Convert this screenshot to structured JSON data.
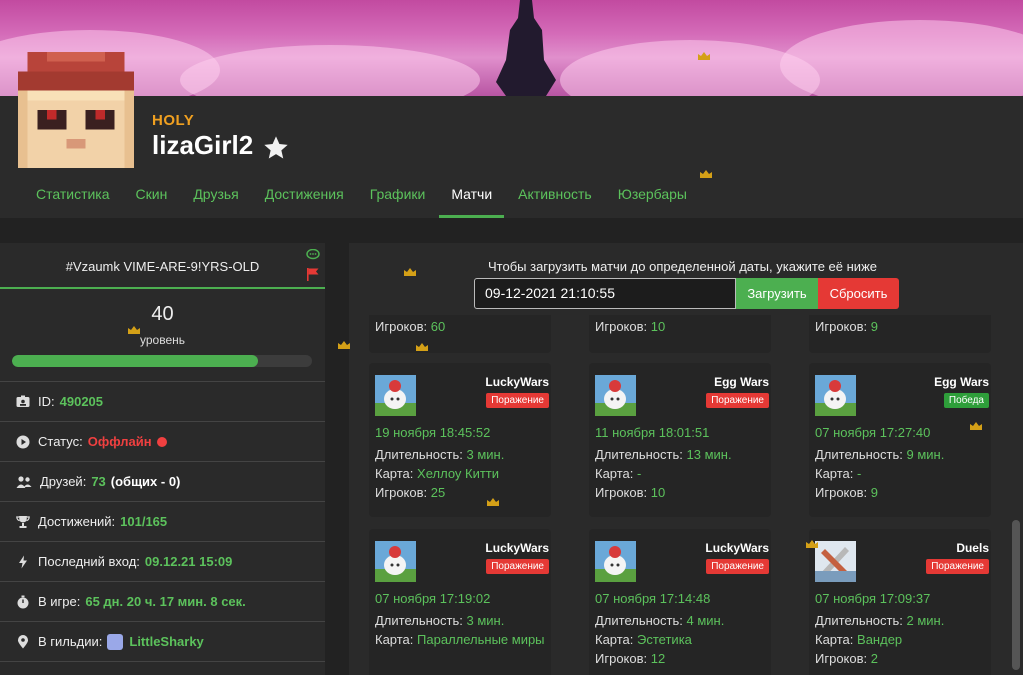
{
  "profile": {
    "rank": "HOLY",
    "username": "lizaGirl2"
  },
  "tabs": [
    "Статистика",
    "Скин",
    "Друзья",
    "Достижения",
    "Графики",
    "Матчи",
    "Активность",
    "Юзербары"
  ],
  "active_tab": "Матчи",
  "sidebar": {
    "motto": "#Vzaumk VIME-ARE-9!YRS-OLD",
    "level": "40",
    "level_label": "уровень",
    "level_progress": 0.82,
    "id_label": "ID:",
    "id_value": "490205",
    "status_label": "Статус:",
    "status_value": "Оффлайн",
    "friends_label": "Друзей:",
    "friends_value": "73",
    "friends_common": "(общих - 0)",
    "achievements_label": "Достижений:",
    "achievements_value": "101/165",
    "last_login_label": "Последний вход:",
    "last_login_value": "09.12.21 15:09",
    "playtime_label": "В игре:",
    "playtime_value": "65 дн. 20 ч. 17 мин. 8 сек.",
    "guild_label": "В гильдии:",
    "guild_value": "LittleSharky"
  },
  "matches": {
    "hint": "Чтобы загрузить матчи до определенной даты, укажите её ниже",
    "date_value": "09-12-2021 21:10:55",
    "load_button": "Загрузить",
    "reset_button": "Сбросить",
    "labels": {
      "duration": "Длительность:",
      "map": "Карта:",
      "players": "Игроков:"
    },
    "partial_players": [
      "60",
      "10",
      "9"
    ],
    "cards": [
      {
        "mode": "LuckyWars",
        "result": "Поражение",
        "win": false,
        "date": "19 ноября 18:45:52",
        "duration": "3 мин.",
        "map": "Хеллоу Китти",
        "players": "25"
      },
      {
        "mode": "Egg Wars",
        "result": "Поражение",
        "win": false,
        "date": "11 ноября 18:01:51",
        "duration": "13 мин.",
        "map": "-",
        "players": "10"
      },
      {
        "mode": "Egg Wars",
        "result": "Победа",
        "win": true,
        "date": "07 ноября 17:27:40",
        "duration": "9 мин.",
        "map": "-",
        "players": "9"
      },
      {
        "mode": "LuckyWars",
        "result": "Поражение",
        "win": false,
        "date": "07 ноября 17:19:02",
        "duration": "3 мин.",
        "map": "Параллельные миры",
        "players": ""
      },
      {
        "mode": "LuckyWars",
        "result": "Поражение",
        "win": false,
        "date": "07 ноября 17:14:48",
        "duration": "4 мин.",
        "map": "Эстетика",
        "players": "12"
      },
      {
        "mode": "Duels",
        "result": "Поражение",
        "win": false,
        "date": "07 ноября 17:09:37",
        "duration": "2 мин.",
        "map": "Вандер",
        "players": "2"
      }
    ]
  },
  "colors": {
    "accent": "#4caf50",
    "rank": "#f0a020",
    "danger": "#e53935"
  }
}
